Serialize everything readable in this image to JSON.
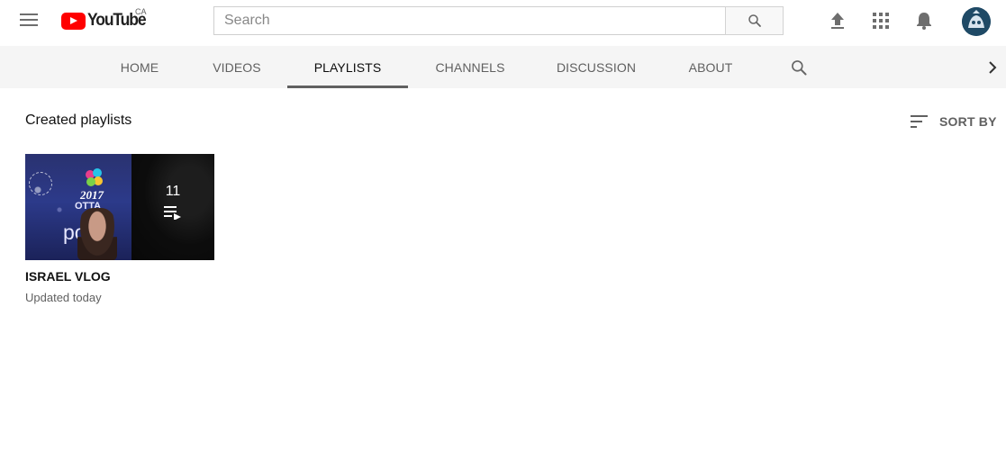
{
  "header": {
    "logo_text": "YouTube",
    "logo_country": "CA",
    "search_placeholder": "Search",
    "icons": [
      "menu-icon",
      "search-icon",
      "upload-icon",
      "apps-icon",
      "notifications-icon",
      "avatar"
    ]
  },
  "tabs": [
    {
      "label": "HOME",
      "active": false
    },
    {
      "label": "VIDEOS",
      "active": false
    },
    {
      "label": "PLAYLISTS",
      "active": true
    },
    {
      "label": "CHANNELS",
      "active": false
    },
    {
      "label": "DISCUSSION",
      "active": false
    },
    {
      "label": "ABOUT",
      "active": false
    }
  ],
  "content": {
    "section_title": "Created playlists",
    "sort_label": "SORT BY",
    "playlists": [
      {
        "title": "ISRAEL VLOG",
        "meta": "Updated today",
        "video_count": "11",
        "thumb_text": {
          "year": "2017",
          "city": "OTTA",
          "overlay": "po"
        }
      }
    ]
  },
  "colors": {
    "brand_red": "#ff0000",
    "tab_bar_bg": "#f5f5f5",
    "text_secondary": "#606060",
    "active_underline": "#606060"
  }
}
